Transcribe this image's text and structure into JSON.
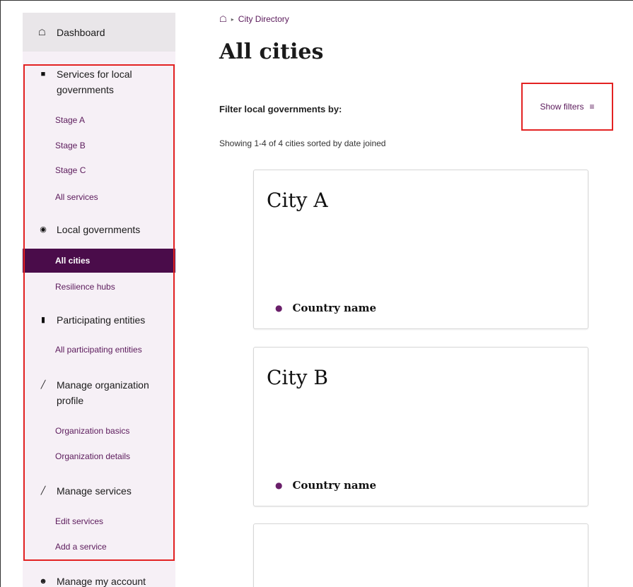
{
  "breadcrumb": {
    "current": "City Directory"
  },
  "page": {
    "title": "All cities"
  },
  "filters": {
    "label": "Filter local governments by:",
    "show_label": "Show filters"
  },
  "results": {
    "summary": "Showing 1-4 of 4 cities sorted by date joined"
  },
  "cities": [
    {
      "name": "City A",
      "country": "Country name"
    },
    {
      "name": "City B",
      "country": "Country name"
    },
    {
      "name": "",
      "country": ""
    }
  ],
  "sidebar": {
    "dashboard": "Dashboard",
    "sections": [
      {
        "label": "Services for local governments",
        "icon": "bag-icon",
        "items": [
          "Stage A",
          "Stage B",
          "Stage C",
          "All services"
        ]
      },
      {
        "label": "Local governments",
        "icon": "globe-icon",
        "items": [
          "All cities",
          "Resilience hubs"
        ]
      },
      {
        "label": "Participating entities",
        "icon": "building-icon",
        "items": [
          "All participating entities"
        ]
      },
      {
        "label": "Manage organization profile",
        "icon": "pencil-icon",
        "items": [
          "Organization basics",
          "Organization details"
        ]
      },
      {
        "label": "Manage services",
        "icon": "pencil-icon",
        "items": [
          "Edit services",
          "Add a service"
        ]
      }
    ],
    "account": "Manage my account",
    "active_item": "All cities"
  },
  "colors": {
    "accent": "#4a0c4a",
    "link": "#5b1a5b",
    "highlight": "#e32222",
    "sidebar_bg": "#f6f0f6"
  }
}
